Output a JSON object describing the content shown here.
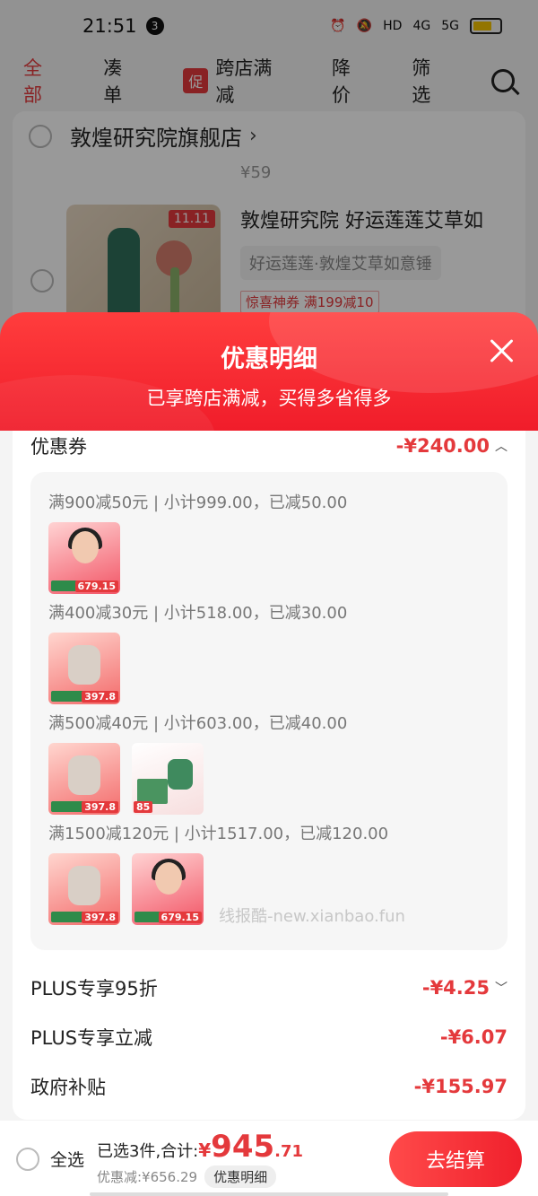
{
  "status_bar": {
    "time": "21:51",
    "notification_count": "3",
    "hd_label": "HD",
    "net_4g": "4G",
    "net_5g": "5G"
  },
  "filters": {
    "tabs": [
      {
        "label": "全部",
        "active": true
      },
      {
        "label": "凑单",
        "active": false
      },
      {
        "label": "跨店满减",
        "badge": "促",
        "active": false
      },
      {
        "label": "降价",
        "active": false
      },
      {
        "label": "筛选",
        "active": false
      }
    ]
  },
  "background_cart": {
    "store_name": "敦煌研究院旗舰店",
    "old_price": "¥59",
    "product_badge": "11.11",
    "product_title": "敦煌研究院 好运莲莲艾草如",
    "product_spec": "好运莲莲·敦煌艾草如意锤",
    "product_coupon": "惊喜神券 满199减10"
  },
  "sheet": {
    "title": "优惠明细",
    "subtitle": "已享跨店满减，买得多省得多",
    "coupon_row": {
      "label": "优惠券",
      "value": "-¥240.00"
    },
    "groups": [
      {
        "text": "满900减50元 | 小计999.00，已减50.00",
        "thumbs": [
          {
            "type": "a",
            "price": "679.15"
          }
        ]
      },
      {
        "text": "满400减30元 | 小计518.00，已减30.00",
        "thumbs": [
          {
            "type": "b",
            "price": "397.8"
          }
        ]
      },
      {
        "text": "满500减40元 | 小计603.00，已减40.00",
        "thumbs": [
          {
            "type": "b",
            "price": "397.8"
          },
          {
            "type": "c",
            "price": "85"
          }
        ]
      },
      {
        "text": "满1500减120元 | 小计1517.00，已减120.00",
        "thumbs": [
          {
            "type": "b",
            "price": "397.8"
          },
          {
            "type": "a",
            "price": "679.15"
          }
        ]
      }
    ],
    "plus_discount": {
      "label": "PLUS专享95折",
      "value": "-¥4.25"
    },
    "plus_reduce": {
      "label": "PLUS专享立减",
      "value": "-¥6.07"
    },
    "gov_subsidy": {
      "label": "政府补贴",
      "value": "-¥155.97"
    },
    "watermark": "线报酷-new.xianbao.fun"
  },
  "bottom_bar": {
    "select_all_label": "全选",
    "summary_prefix": "已选3件,合计:",
    "currency": "¥",
    "total_int": "945",
    "total_dec": ".71",
    "saved_text": "优惠减:¥656.29",
    "detail_label": "优惠明细",
    "checkout_label": "去结算"
  },
  "colors": {
    "accent": "#e4393c",
    "gradient_start": "#ff3d3d",
    "gradient_end": "#f01c2a"
  }
}
